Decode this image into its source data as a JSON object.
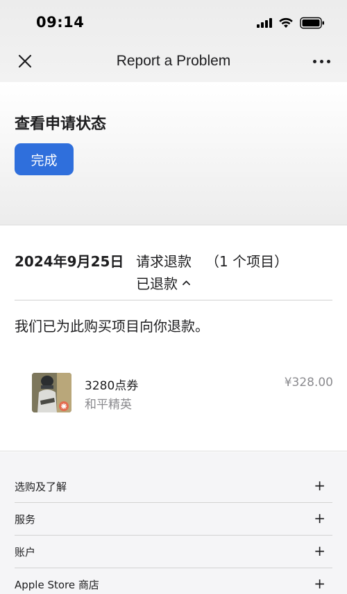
{
  "status_bar": {
    "time": "09:14",
    "icons": [
      "signal-icon",
      "wifi-icon",
      "battery-icon"
    ]
  },
  "nav": {
    "title": "Report a Problem",
    "left_icon": "close-icon",
    "right_icon": "more-icon"
  },
  "request_status": {
    "heading": "查看申请状态",
    "done_label": "完成"
  },
  "order": {
    "date": "2024年9月25日",
    "type": "请求退款",
    "count": "（1 个项目）",
    "status": "已退款",
    "message": "我们已为此购买项目向你退款。",
    "items": [
      {
        "name": "3280点券",
        "subtitle": "和平精英",
        "price": "¥328.00"
      }
    ]
  },
  "footer": {
    "rows": [
      {
        "label": "选购及了解",
        "icon": "plus-icon"
      },
      {
        "label": "服务",
        "icon": "plus-icon"
      },
      {
        "label": "账户",
        "icon": "plus-icon"
      },
      {
        "label": "Apple Store 商店",
        "icon": "plus-icon"
      }
    ]
  },
  "colors": {
    "accent": "#2f6fdc",
    "text_primary": "#1d1d1f",
    "text_secondary": "#8a8a8e"
  }
}
